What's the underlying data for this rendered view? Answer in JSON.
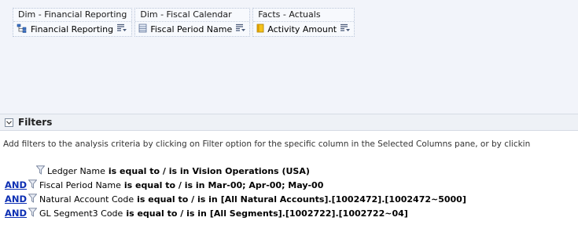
{
  "selected_columns": [
    {
      "header": "Dim - Financial Reporting",
      "column": "Financial Reporting",
      "icon": "hierarchy-icon"
    },
    {
      "header": "Dim - Fiscal Calendar",
      "column": "Fiscal Period Name",
      "icon": "attribute-column-icon"
    },
    {
      "header": "Facts - Actuals",
      "column": "Activity Amount",
      "icon": "measure-column-icon"
    }
  ],
  "filters": {
    "title": "Filters",
    "collapse_icon": "chevron-collapse-icon",
    "hint": "Add filters to the analysis criteria by clicking on Filter option for the specific column in the Selected Columns pane, or by clickin",
    "items": [
      {
        "conj": "",
        "column": "Ledger Name",
        "operator": "is equal to / is in",
        "value": "Vision Operations (USA)"
      },
      {
        "conj": "AND",
        "column": "Fiscal Period Name",
        "operator": "is equal to / is in",
        "value": "Mar-00; Apr-00; May-00"
      },
      {
        "conj": "AND",
        "column": "Natural Account Code",
        "operator": "is equal to / is in",
        "value": "[All Natural Accounts].[1002472].[1002472~5000]"
      },
      {
        "conj": "AND",
        "column": "GL Segment3 Code",
        "operator": "is equal to / is in",
        "value": "[All Segments].[1002722].[1002722~04]"
      }
    ]
  },
  "colors": {
    "link": "#0d2fb3",
    "panel_bg": "#f2f4fa",
    "bar_bg": "#eef1f6"
  }
}
